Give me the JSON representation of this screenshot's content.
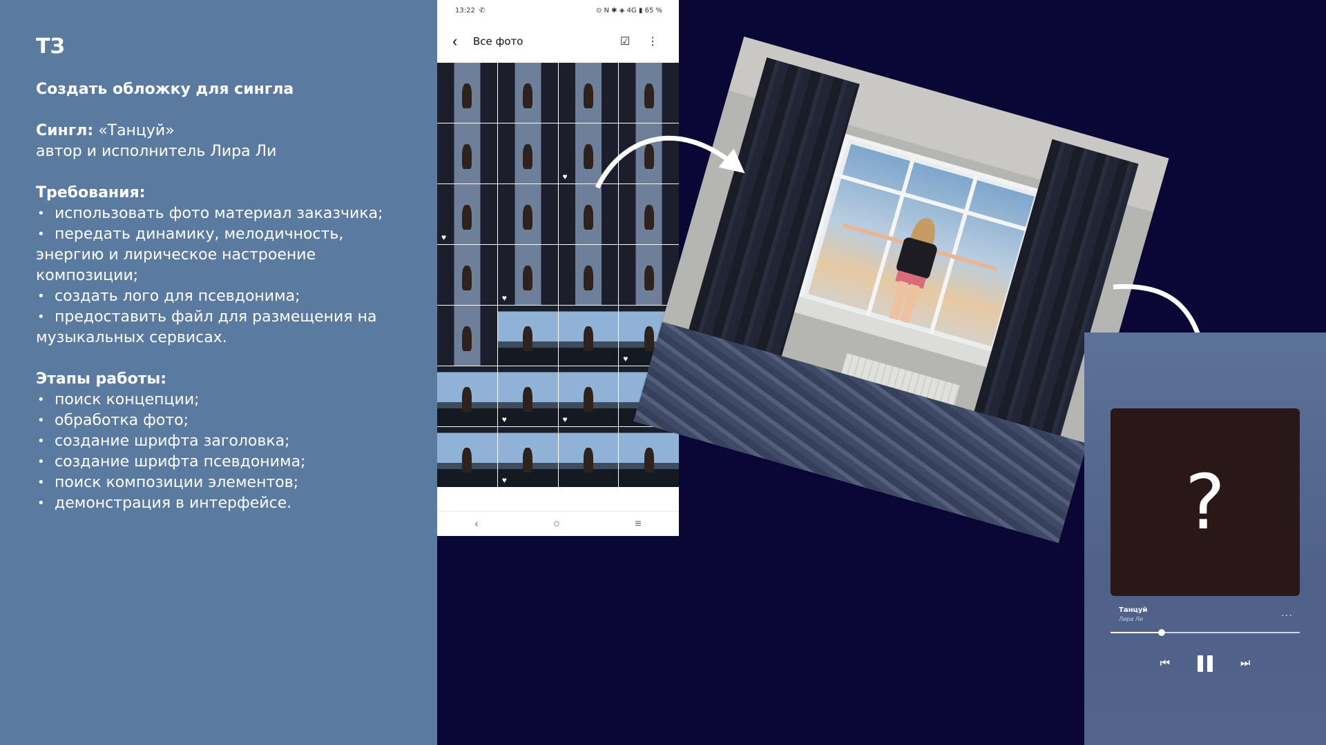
{
  "brief": {
    "title": "ТЗ",
    "task": "Создать обложку для сингла",
    "single_label": "Сингл:",
    "single_value": " «Танцуй»",
    "author_line": "автор и исполнитель Лира Ли",
    "requirements_label": "Требования:",
    "requirements": [
      "использовать фото материал заказчика;",
      "передать динамику, мелодичность, энергию и лирическое настроение композиции;",
      "создать лого для псевдонима;",
      "предоставить файл для размещения на музыкальных сервисах."
    ],
    "stages_label": "Этапы работы:",
    "stages": [
      "поиск концепции;",
      "обработка фото;",
      "создание шрифта заголовка;",
      "создание шрифта псевдонима;",
      "поиск композиции элементов;",
      "демонстрация в интерфейсе."
    ]
  },
  "phone": {
    "time": "13:22",
    "status_right": "⊙ N ✱ ◈ 4G ▮ 65 %",
    "gallery_title": "Все фото",
    "icons": {
      "back": "back-arrow-icon",
      "select": "select-check-icon",
      "menu": "more-vert-icon"
    }
  },
  "player": {
    "cover_placeholder": "?",
    "track_title": "Танцуй",
    "track_artist": "Лира Ли",
    "progress": 0.27,
    "icons": [
      "skip-previous-icon",
      "pause-icon",
      "skip-next-icon"
    ]
  },
  "colors": {
    "background": "#0a0636",
    "panel": "#5a7aa0",
    "cover": "#2a1819"
  }
}
